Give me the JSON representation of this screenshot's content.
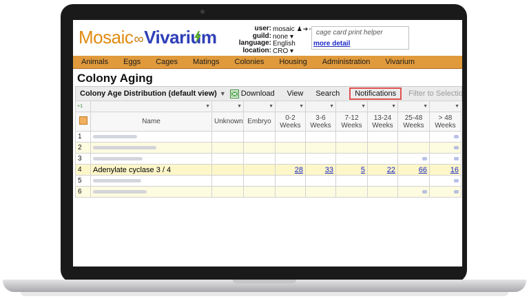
{
  "app": {
    "logo_part1": "Mosaic",
    "logo_part2": "Vivarium",
    "logo_ring_glyph": "∞"
  },
  "user_panel": {
    "labels": {
      "user": "user:",
      "guild": "guild:",
      "language": "language:",
      "location": "location:"
    },
    "values": {
      "user": "mosaic",
      "guild": "none ▾",
      "language": "English",
      "location": "CRO ▾"
    }
  },
  "helper": {
    "text": "cage card print helper",
    "link": "more detail"
  },
  "menu": {
    "items": [
      "Animals",
      "Eggs",
      "Cages",
      "Matings",
      "Colonies",
      "Housing",
      "Administration",
      "Vivarium"
    ]
  },
  "page": {
    "title": "Colony Aging"
  },
  "toolbar": {
    "view_select": "Colony Age Distribution (default view)",
    "download": "Download",
    "view": "View",
    "search": "Search",
    "notifications": "Notifications",
    "filter_to_selection": "Filter to Selection"
  },
  "grid": {
    "filter_plus": "+1",
    "headers": {
      "name": "Name",
      "unknown": "Unknown",
      "embryo": "Embryo",
      "w0_2": "0-2 Weeks",
      "w3_6": "3-6 Weeks",
      "w7_12": "7-12 Weeks",
      "w13_24": "13-24 Weeks",
      "w25_48": "25-48 Weeks",
      "w48": "> 48 Weeks"
    },
    "rows": [
      {
        "n": "1"
      },
      {
        "n": "2"
      },
      {
        "n": "3"
      },
      {
        "n": "4",
        "name": "Adenylate cyclase 3 / 4",
        "w0_2": "28",
        "w3_6": "33",
        "w7_12": "5",
        "w13_24": "22",
        "w25_48": "66",
        "w48": "16"
      },
      {
        "n": "5"
      },
      {
        "n": "6"
      }
    ]
  },
  "colors": {
    "menubar": "#e09a3c",
    "logo_orange": "#e08a10",
    "logo_blue": "#2f3fb8",
    "link_blue": "#1a28c8",
    "highlight_red": "#e05050"
  }
}
